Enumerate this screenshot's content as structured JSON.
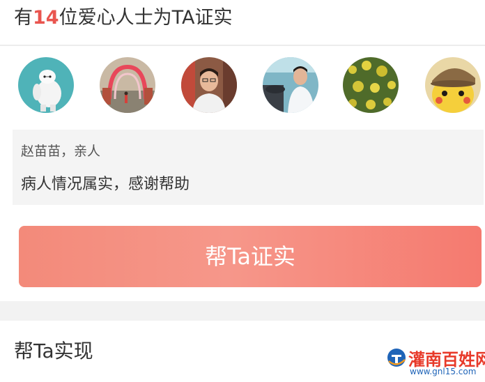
{
  "header": {
    "prefix": "有",
    "count": "14",
    "suffix": "位爱心人士为TA证实"
  },
  "avatars": [
    {
      "name": "avatar-robot"
    },
    {
      "name": "avatar-arch"
    },
    {
      "name": "avatar-man-1"
    },
    {
      "name": "avatar-man-2"
    },
    {
      "name": "avatar-flowers"
    },
    {
      "name": "avatar-pikachu"
    }
  ],
  "comment": {
    "author": "赵苗苗，亲人",
    "text": "病人情况属实，感谢帮助"
  },
  "verify_button": {
    "label": "帮Ta证实"
  },
  "help_section": {
    "title": "帮Ta实现"
  },
  "watermark": {
    "name": "灌南百姓网",
    "url": "www.gnl15.com"
  },
  "colors": {
    "accent": "#e9554f",
    "button": "#f6978a",
    "watermark_red": "#e83a2a",
    "watermark_blue": "#1f64b8"
  }
}
